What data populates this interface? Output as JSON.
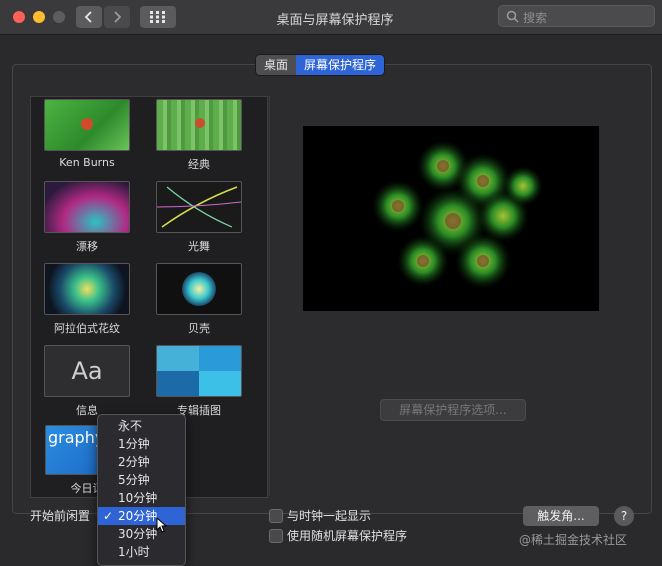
{
  "window": {
    "title": "桌面与屏幕保护程序"
  },
  "toolbar": {
    "back_icon": "chevron-left-icon",
    "forward_icon": "chevron-right-icon",
    "grid_icon": "grid-icon"
  },
  "search": {
    "placeholder": "搜索"
  },
  "tabs": [
    {
      "label": "桌面",
      "active": false
    },
    {
      "label": "屏幕保护程序",
      "active": true
    }
  ],
  "savers": [
    {
      "label": "Ken Burns"
    },
    {
      "label": "经典"
    },
    {
      "label": "漂移"
    },
    {
      "label": "光舞"
    },
    {
      "label": "阿拉伯式花纹"
    },
    {
      "label": "贝壳"
    },
    {
      "label": "信息",
      "thumb_text": "Aa"
    },
    {
      "label": "专辑插图"
    },
    {
      "label": "今日词",
      "thumb_text": "graphy"
    }
  ],
  "preview": {
    "options_button": "屏幕保护程序选项..."
  },
  "bottom": {
    "start_label": "开始前闲置",
    "show_clock": "与时钟一起显示",
    "random": "使用随机屏幕保护程序",
    "hot_corners": "触发角...",
    "help": "?"
  },
  "idle_menu": {
    "options": [
      "永不",
      "1分钟",
      "2分钟",
      "5分钟",
      "10分钟",
      "20分钟",
      "30分钟",
      "1小时"
    ],
    "selected": "20分钟",
    "check": "✓"
  },
  "watermark": "@稀土掘金技术社区",
  "colors": {
    "accent": "#2f64d6",
    "close": "#fe5f57",
    "minimize": "#febc2e"
  }
}
